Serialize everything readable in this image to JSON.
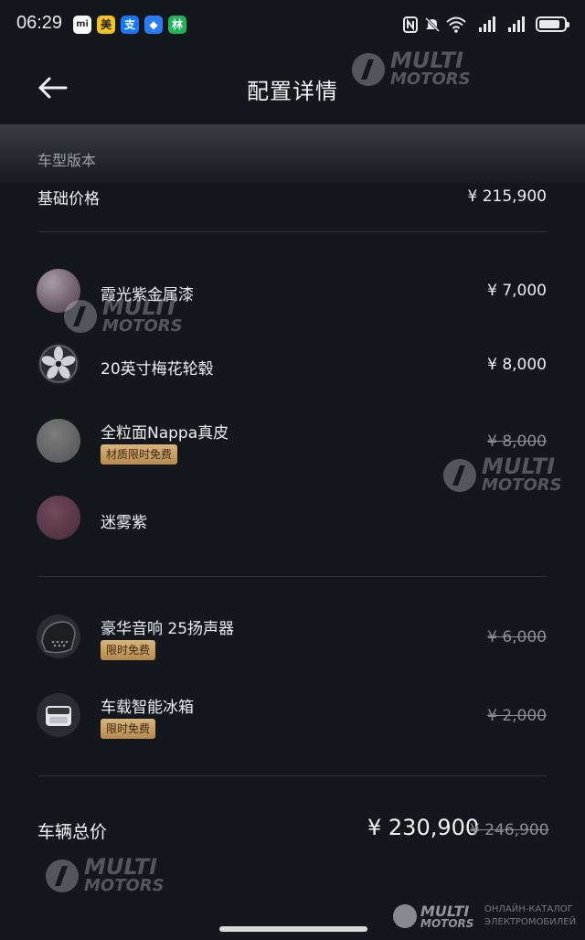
{
  "status_bar": {
    "time": "06:29",
    "app_icons": [
      {
        "name": "mi-icon",
        "glyph": "mi",
        "color": "#ffffff",
        "text_color": "#333333"
      },
      {
        "name": "meituan-icon",
        "glyph": "美",
        "color": "#f5c518",
        "text_color": "#222222"
      },
      {
        "name": "alipay-icon",
        "glyph": "支",
        "color": "#1677ff",
        "text_color": "#ffffff"
      },
      {
        "name": "shield-app-icon",
        "glyph": "◆",
        "color": "#2a7bf6",
        "text_color": "#ffffff"
      },
      {
        "name": "tree-app-icon",
        "glyph": "林",
        "color": "#21b35c",
        "text_color": "#ffffff"
      }
    ],
    "system_icons": [
      "nfc-icon",
      "mute-icon",
      "wifi-icon",
      "signal-1-icon",
      "signal-2-icon",
      "battery-icon"
    ]
  },
  "header": {
    "back_icon": "arrow-left-icon",
    "title": "配置详情"
  },
  "section": {
    "label": "车型版本"
  },
  "base": {
    "label": "基础价格",
    "price": "¥ 215,900"
  },
  "options": [
    {
      "name": "霞光紫金属漆",
      "price": "¥ 7,000",
      "strike": false,
      "badge": "",
      "swatch": "paint-swatch"
    },
    {
      "name": "20英寸梅花轮毂",
      "price": "¥ 8,000",
      "strike": false,
      "badge": "",
      "swatch": "wheel-swatch"
    },
    {
      "name": "全粒面Nappa真皮",
      "price": "¥ 8,000",
      "strike": true,
      "badge": "材质限时免费",
      "swatch": "leather-swatch"
    },
    {
      "name": "迷雾紫",
      "price": "",
      "strike": false,
      "badge": "",
      "swatch": "interior-color-swatch"
    }
  ],
  "extras": [
    {
      "name": "豪华音响 25扬声器",
      "price": "¥ 6,000",
      "strike": true,
      "badge": "限时免费",
      "swatch": "speaker-thumb"
    },
    {
      "name": "车载智能冰箱",
      "price": "¥ 2,000",
      "strike": true,
      "badge": "限时免费",
      "swatch": "fridge-thumb"
    }
  ],
  "total": {
    "label": "车辆总价",
    "price": "¥ 230,900",
    "original_price": "¥ 246,900"
  },
  "watermark": {
    "line1": "MULTI",
    "line2": "MOTORS",
    "footer_line1": "ОНЛАЙН-КАТАЛОГ",
    "footer_line2": "ЭЛЕКТРОМОБИЛЕЙ"
  },
  "colors": {
    "background": "#14181d",
    "badge_gold": "#c9a066",
    "paint_purple": "#6f5f6c",
    "interior_purple": "#5a3a48"
  }
}
